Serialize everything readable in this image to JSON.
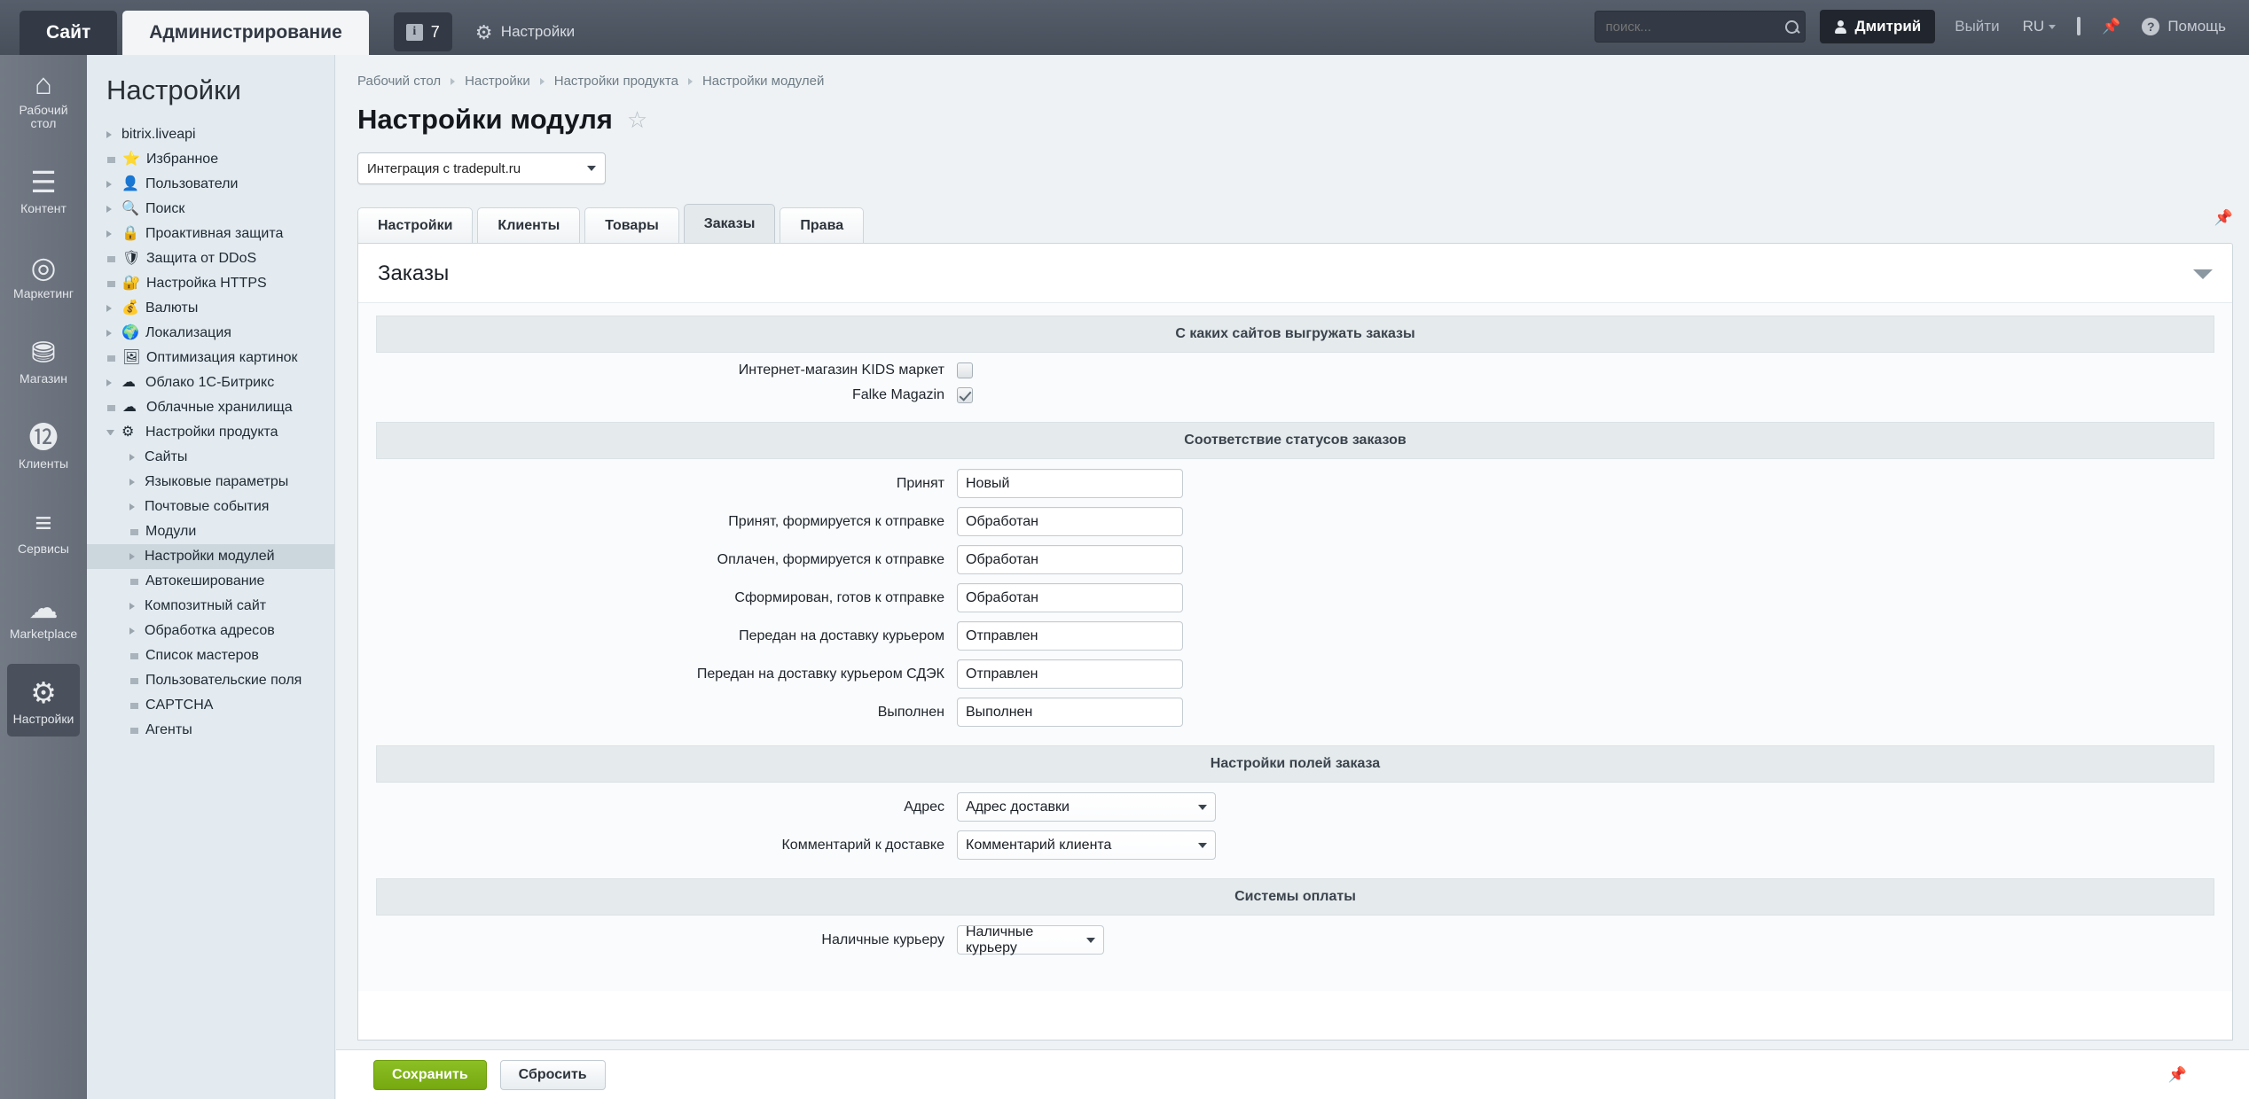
{
  "topbar": {
    "site_tab": "Сайт",
    "admin_tab": "Администрирование",
    "counter": "7",
    "settings": "Настройки",
    "search_placeholder": "поиск...",
    "search_value": "",
    "user": "Дмитрий",
    "logout": "Выйти",
    "lang": "RU",
    "help": "Помощь"
  },
  "rail": {
    "items": [
      {
        "label": "Рабочий стол",
        "glyph": "⌂",
        "icon": "home-icon",
        "active": false
      },
      {
        "label": "Контент",
        "glyph": "☰",
        "icon": "document-icon",
        "active": false
      },
      {
        "label": "Маркетинг",
        "glyph": "◎",
        "icon": "target-icon",
        "active": false
      },
      {
        "label": "Магазин",
        "glyph": "⛃",
        "icon": "basket-icon",
        "active": false
      },
      {
        "label": "Клиенты",
        "glyph": "⓬",
        "icon": "clients-24-icon",
        "active": false
      },
      {
        "label": "Сервисы",
        "glyph": "≡",
        "icon": "layers-icon",
        "active": false
      },
      {
        "label": "Marketplace",
        "glyph": "☁",
        "icon": "cloud-download-icon",
        "active": false
      },
      {
        "label": "Настройки",
        "glyph": "⚙",
        "icon": "gear-icon",
        "active": true
      }
    ]
  },
  "sidebar": {
    "title": "Настройки",
    "items": [
      {
        "label": "bitrix.liveapi",
        "marker": "tri",
        "icon": "",
        "level": 0,
        "active": false
      },
      {
        "label": "Избранное",
        "marker": "sq",
        "icon": "⭐",
        "level": 0,
        "active": false
      },
      {
        "label": "Пользователи",
        "marker": "tri",
        "icon": "👤",
        "level": 0,
        "active": false
      },
      {
        "label": "Поиск",
        "marker": "tri",
        "icon": "🔍",
        "level": 0,
        "active": false
      },
      {
        "label": "Проактивная защита",
        "marker": "tri",
        "icon": "🔒",
        "level": 0,
        "active": false
      },
      {
        "label": "Защита от DDoS",
        "marker": "sq",
        "icon": "🛡",
        "level": 0,
        "active": false
      },
      {
        "label": "Настройка HTTPS",
        "marker": "sq",
        "icon": "🔐",
        "level": 0,
        "active": false
      },
      {
        "label": "Валюты",
        "marker": "tri",
        "icon": "💰",
        "level": 0,
        "active": false
      },
      {
        "label": "Локализация",
        "marker": "tri",
        "icon": "🌍",
        "level": 0,
        "active": false
      },
      {
        "label": "Оптимизация картинок",
        "marker": "sq",
        "icon": "🖼",
        "level": 0,
        "active": false
      },
      {
        "label": "Облако 1С-Битрикс",
        "marker": "tri",
        "icon": "☁",
        "level": 0,
        "active": false
      },
      {
        "label": "Облачные хранилища",
        "marker": "sq",
        "icon": "☁",
        "level": 0,
        "active": false
      },
      {
        "label": "Настройки продукта",
        "marker": "tri-dn",
        "icon": "⚙",
        "level": 0,
        "active": false
      },
      {
        "label": "Сайты",
        "marker": "tri",
        "icon": "",
        "level": 1,
        "active": false
      },
      {
        "label": "Языковые параметры",
        "marker": "tri",
        "icon": "",
        "level": 1,
        "active": false
      },
      {
        "label": "Почтовые события",
        "marker": "tri",
        "icon": "",
        "level": 1,
        "active": false
      },
      {
        "label": "Модули",
        "marker": "sq",
        "icon": "",
        "level": 1,
        "active": false
      },
      {
        "label": "Настройки модулей",
        "marker": "tri",
        "icon": "",
        "level": 1,
        "active": true
      },
      {
        "label": "Автокеширование",
        "marker": "sq",
        "icon": "",
        "level": 1,
        "active": false
      },
      {
        "label": "Композитный сайт",
        "marker": "tri",
        "icon": "",
        "level": 1,
        "active": false
      },
      {
        "label": "Обработка адресов",
        "marker": "tri",
        "icon": "",
        "level": 1,
        "active": false
      },
      {
        "label": "Список мастеров",
        "marker": "sq",
        "icon": "",
        "level": 1,
        "active": false
      },
      {
        "label": "Пользовательские поля",
        "marker": "sq",
        "icon": "",
        "level": 1,
        "active": false
      },
      {
        "label": "CAPTCHA",
        "marker": "sq",
        "icon": "",
        "level": 1,
        "active": false
      },
      {
        "label": "Агенты",
        "marker": "sq",
        "icon": "",
        "level": 1,
        "active": false
      }
    ]
  },
  "breadcrumb": [
    "Рабочий стол",
    "Настройки",
    "Настройки продукта",
    "Настройки модулей"
  ],
  "page": {
    "title": "Настройки модуля",
    "module_select_value": "Интеграция с tradepult.ru"
  },
  "tabs": [
    {
      "label": "Настройки",
      "active": false
    },
    {
      "label": "Клиенты",
      "active": false
    },
    {
      "label": "Товары",
      "active": false
    },
    {
      "label": "Заказы",
      "active": true
    },
    {
      "label": "Права",
      "active": false
    }
  ],
  "card": {
    "heading": "Заказы",
    "sections": [
      {
        "id": "sites",
        "title": "С каких сайтов выгружать заказы",
        "type": "checkbox",
        "rows": [
          {
            "label": "Интернет-магазин KIDS маркет",
            "checked": false
          },
          {
            "label": "Falke Magazin",
            "checked": true
          }
        ]
      },
      {
        "id": "statuses",
        "title": "Соответствие статусов заказов",
        "type": "text",
        "rows": [
          {
            "label": "Принят",
            "value": "Новый"
          },
          {
            "label": "Принят, формируется к отправке",
            "value": "Обработан"
          },
          {
            "label": "Оплачен, формируется к отправке",
            "value": "Обработан"
          },
          {
            "label": "Сформирован, готов к отправке",
            "value": "Обработан"
          },
          {
            "label": "Передан на доставку курьером",
            "value": "Отправлен"
          },
          {
            "label": "Передан на доставку курьером СДЭК",
            "value": "Отправлен"
          },
          {
            "label": "Выполнен",
            "value": "Выполнен"
          }
        ]
      },
      {
        "id": "fields",
        "title": "Настройки полей заказа",
        "type": "select",
        "rows": [
          {
            "label": "Адрес",
            "value": "Адрес доставки"
          },
          {
            "label": "Комментарий к доставке",
            "value": "Комментарий клиента"
          }
        ]
      },
      {
        "id": "payments",
        "title": "Системы оплаты",
        "type": "select-narrow",
        "rows": [
          {
            "label": "Наличные курьеру",
            "value": "Наличные курьеру"
          }
        ]
      }
    ]
  },
  "buttons": {
    "save": "Сохранить",
    "reset": "Сбросить"
  }
}
